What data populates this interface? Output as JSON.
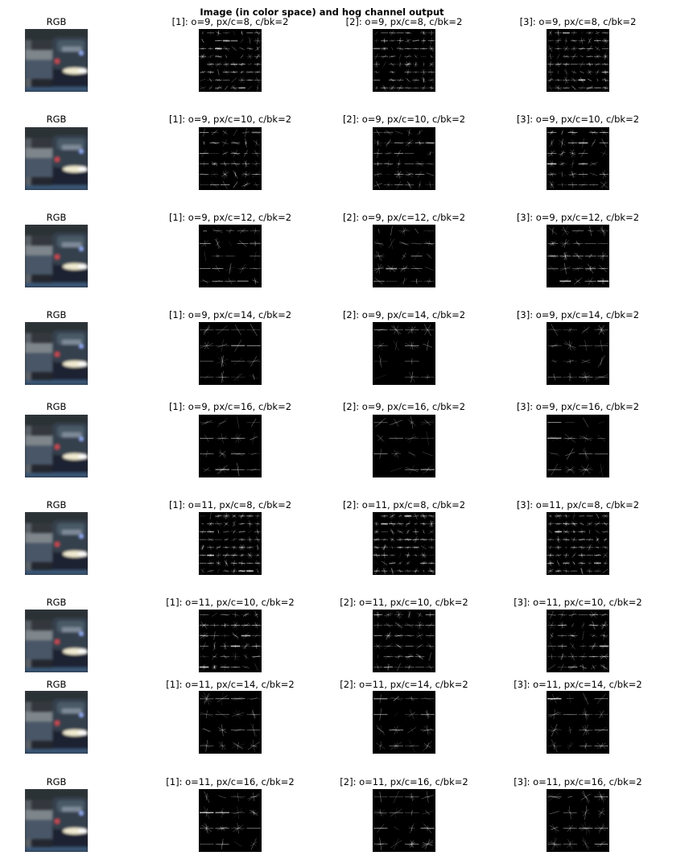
{
  "figure": {
    "title": "Image (in color space) and hog channel output",
    "rgb_label": "RGB",
    "rows": [
      {
        "titles": [
          "[1]: o=9, px/c=8, c/bk=2",
          "[2]: o=9, px/c=8, c/bk=2",
          "[3]: o=9, px/c=8, c/bk=2"
        ]
      },
      {
        "titles": [
          "[1]: o=9, px/c=10, c/bk=2",
          "[2]: o=9, px/c=10, c/bk=2",
          "[3]: o=9, px/c=10, c/bk=2"
        ]
      },
      {
        "titles": [
          "[1]: o=9, px/c=12, c/bk=2",
          "[2]: o=9, px/c=12, c/bk=2",
          "[3]: o=9, px/c=12, c/bk=2"
        ]
      },
      {
        "titles": [
          "[1]: o=9, px/c=14, c/bk=2",
          "[2]: o=9, px/c=14, c/bk=2",
          "[3]: o=9, px/c=14, c/bk=2"
        ]
      },
      {
        "titles": [
          "[1]: o=9, px/c=16, c/bk=2",
          "[2]: o=9, px/c=16, c/bk=2",
          "[3]: o=9, px/c=16, c/bk=2"
        ]
      },
      {
        "titles": [
          "[1]: o=11, px/c=8, c/bk=2",
          "[2]: o=11, px/c=8, c/bk=2",
          "[3]: o=11, px/c=8, c/bk=2"
        ]
      },
      {
        "titles": [
          "[1]: o=11, px/c=10, c/bk=2",
          "[2]: o=11, px/c=10, c/bk=2",
          "[3]: o=11, px/c=10, c/bk=2"
        ]
      },
      {
        "titles": [
          "[1]: o=11, px/c=14, c/bk=2",
          "[2]: o=11, px/c=14, c/bk=2",
          "[3]: o=11, px/c=14, c/bk=2"
        ]
      },
      {
        "titles": [
          "[1]: o=11, px/c=16, c/bk=2",
          "[2]: o=11, px/c=16, c/bk=2",
          "[3]: o=11, px/c=16, c/bk=2"
        ]
      }
    ]
  },
  "chart_data": {
    "type": "image-grid",
    "title": "Image (in color space) and hog channel output",
    "columns": [
      "RGB",
      "[1]",
      "[2]",
      "[3]"
    ],
    "hog_params": [
      {
        "orientations": 9,
        "pixels_per_cell": 8,
        "cells_per_block": 2
      },
      {
        "orientations": 9,
        "pixels_per_cell": 10,
        "cells_per_block": 2
      },
      {
        "orientations": 9,
        "pixels_per_cell": 12,
        "cells_per_block": 2
      },
      {
        "orientations": 9,
        "pixels_per_cell": 14,
        "cells_per_block": 2
      },
      {
        "orientations": 9,
        "pixels_per_cell": 16,
        "cells_per_block": 2
      },
      {
        "orientations": 11,
        "pixels_per_cell": 8,
        "cells_per_block": 2
      },
      {
        "orientations": 11,
        "pixels_per_cell": 10,
        "cells_per_block": 2
      },
      {
        "orientations": 11,
        "pixels_per_cell": 14,
        "cells_per_block": 2
      },
      {
        "orientations": 11,
        "pixels_per_cell": 16,
        "cells_per_block": 2
      }
    ],
    "hog_background": "#000000",
    "hog_foreground": "#ffffff"
  }
}
